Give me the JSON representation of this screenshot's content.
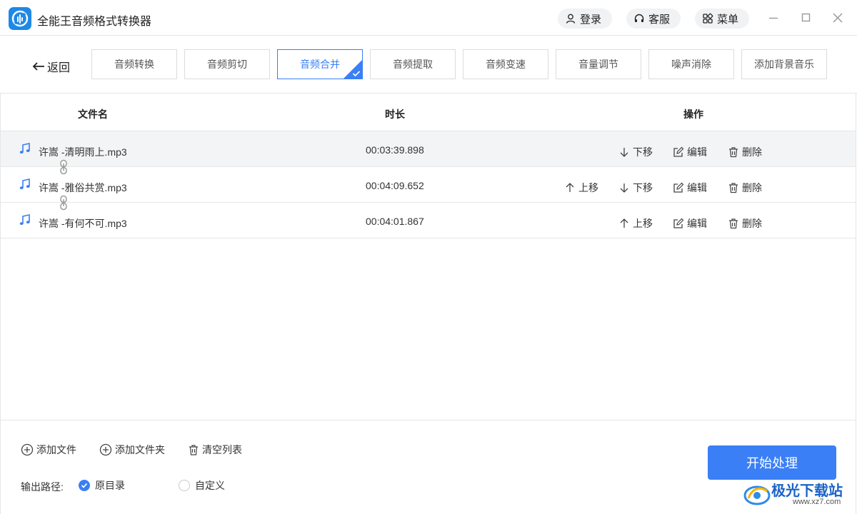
{
  "app": {
    "title": "全能王音频格式转换器",
    "accent": "#3a7ff5"
  },
  "header": {
    "login": "登录",
    "service": "客服",
    "menu": "菜单"
  },
  "toolbar": {
    "back": "返回",
    "tabs": [
      "音频转换",
      "音频剪切",
      "音频合并",
      "音频提取",
      "音频变速",
      "音量调节",
      "噪声消除",
      "添加背景音乐"
    ],
    "active_tab": "音频合并"
  },
  "table": {
    "headers": {
      "name": "文件名",
      "duration": "时长",
      "actions": "操作"
    },
    "rows": [
      {
        "name": "许嵩 -清明雨上.mp3",
        "duration": "00:03:39.898"
      },
      {
        "name": "许嵩 -雅俗共赏.mp3",
        "duration": "00:04:09.652"
      },
      {
        "name": "许嵩 -有何不可.mp3",
        "duration": "00:04:01.867"
      }
    ],
    "actions": {
      "up": "上移",
      "down": "下移",
      "edit": "编辑",
      "delete": "删除"
    }
  },
  "footer": {
    "add_file": "添加文件",
    "add_folder": "添加文件夹",
    "clear_list": "清空列表",
    "output_label": "输出路径:",
    "option_original": "原目录",
    "option_custom": "自定义",
    "start": "开始处理"
  },
  "watermark": {
    "text": "极光下载站",
    "url": "www.xz7.com"
  }
}
